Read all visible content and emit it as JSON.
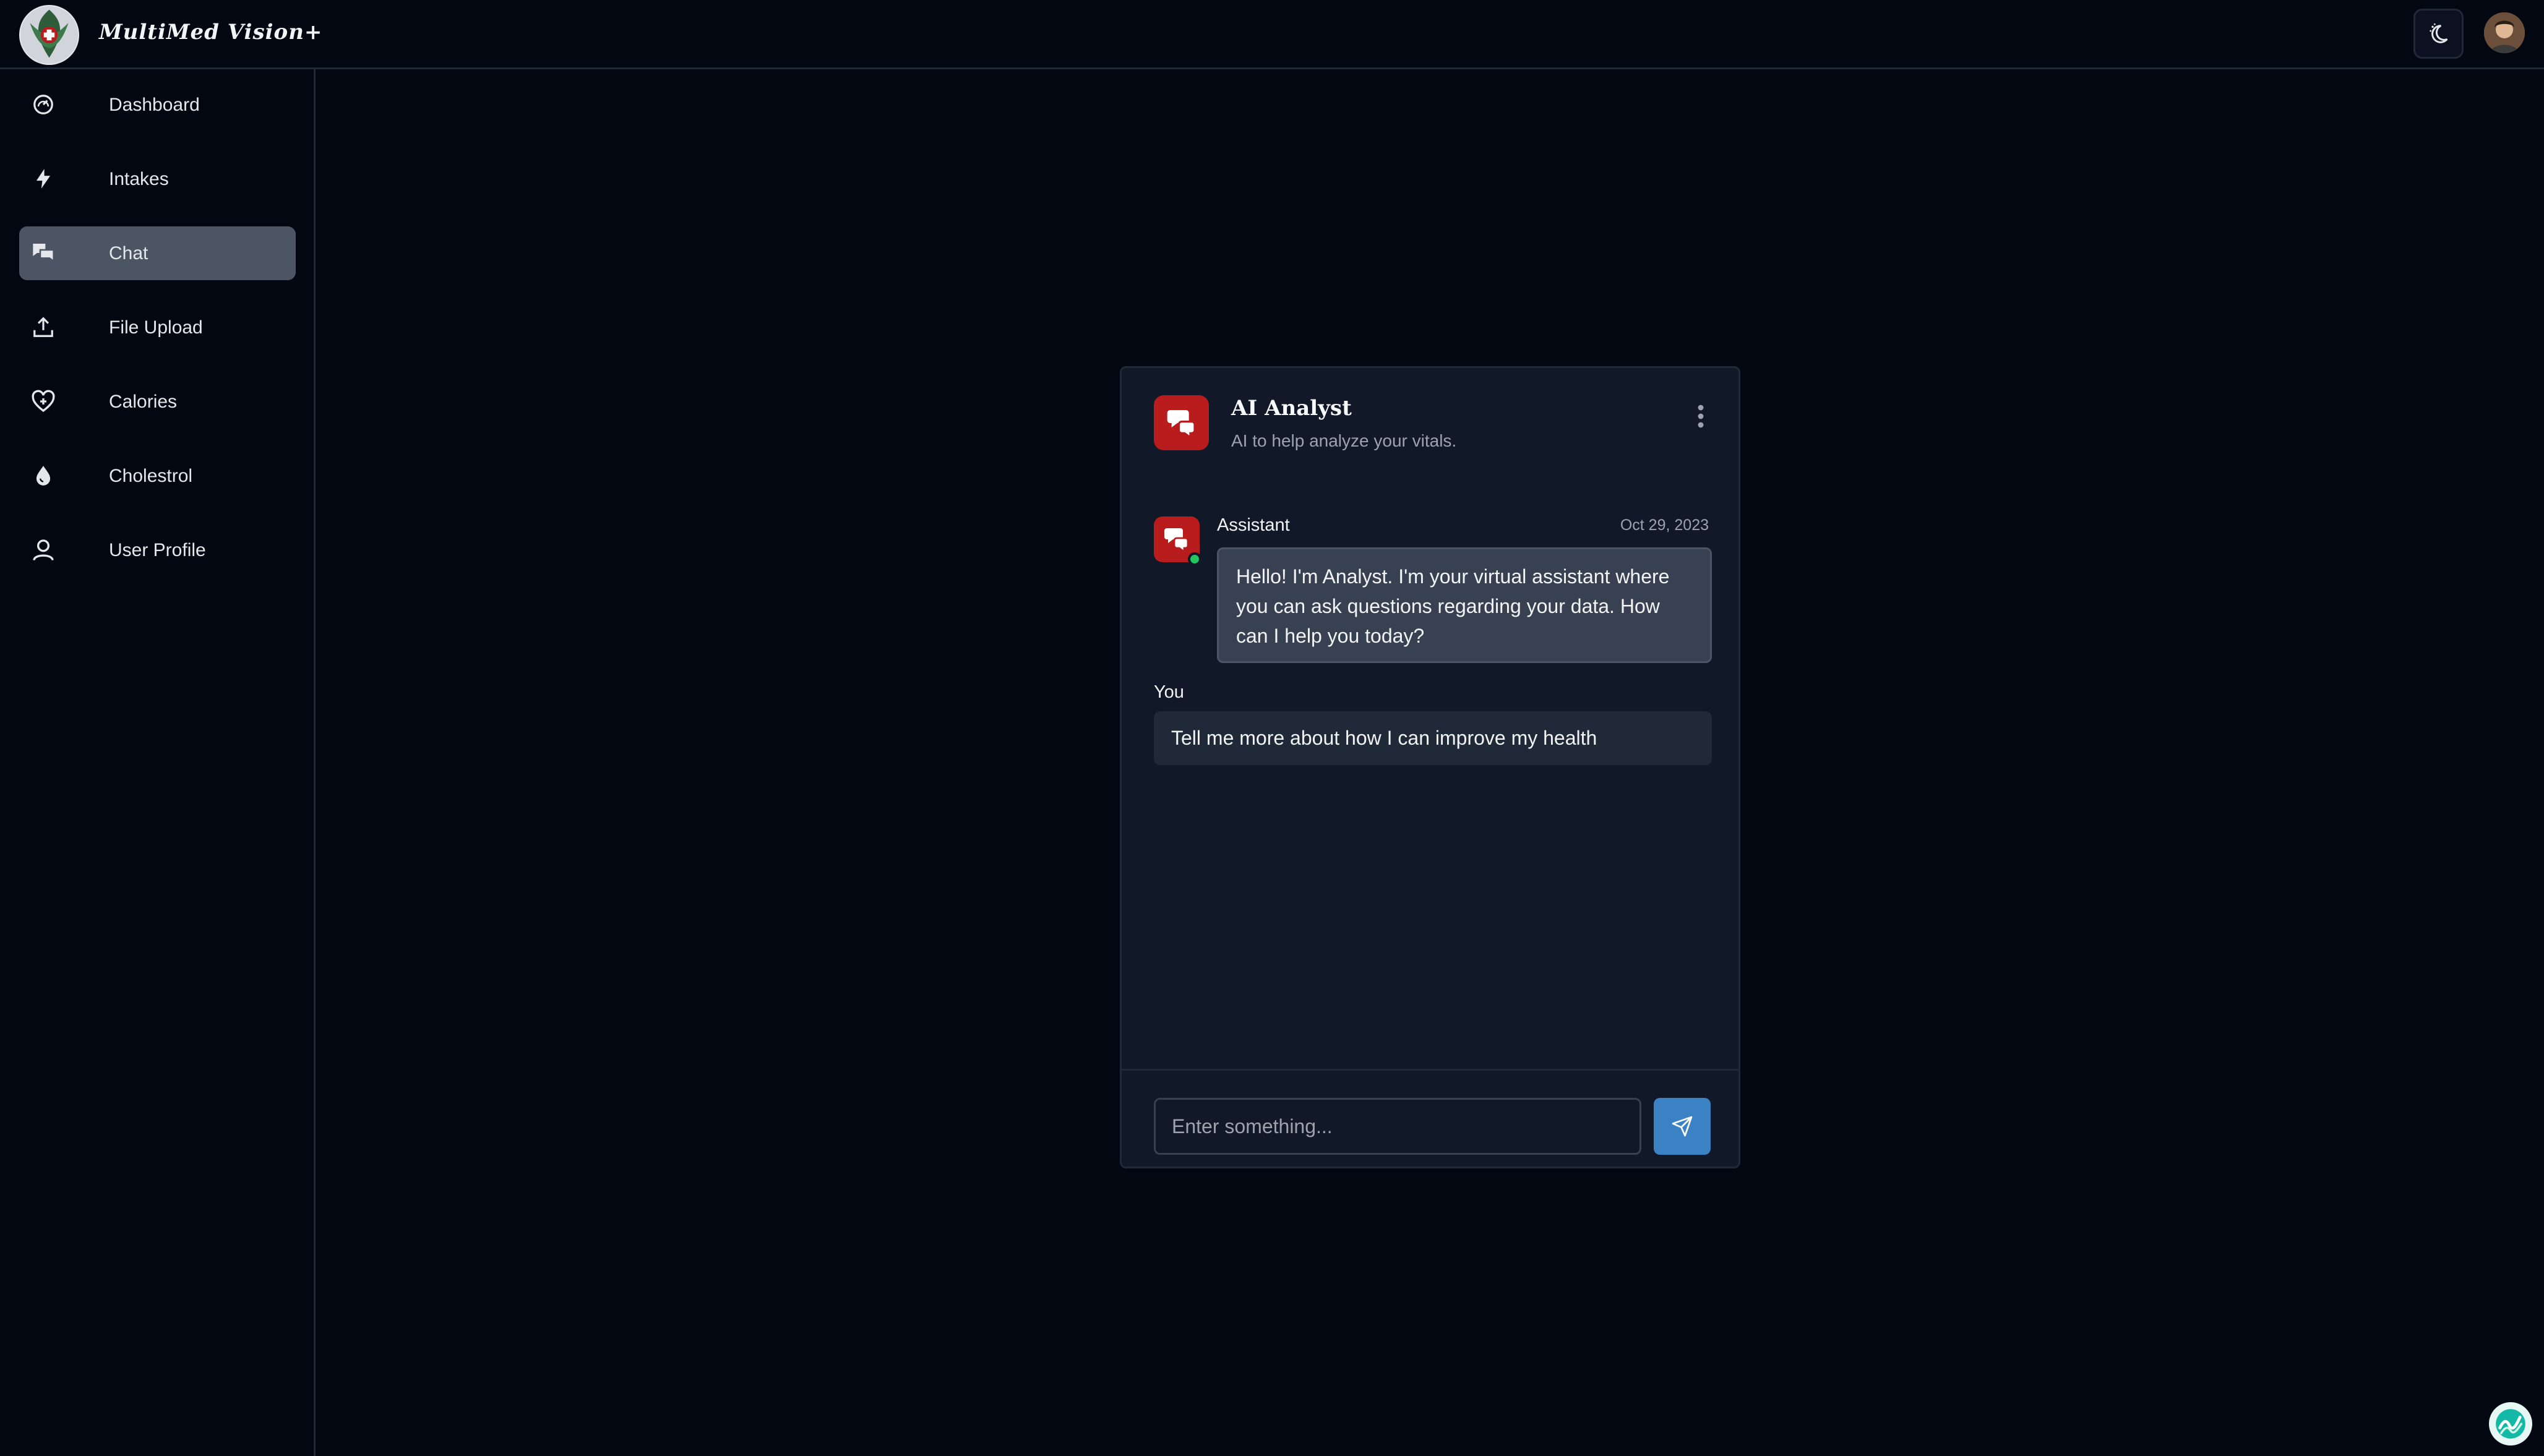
{
  "app": {
    "title": "MultiMed Vision+"
  },
  "header": {
    "theme_toggle_icon": "moon-sun-icon",
    "avatar_icon": "user-avatar"
  },
  "sidebar": {
    "items": [
      {
        "label": "Dashboard",
        "icon": "dashboard-icon",
        "active": false
      },
      {
        "label": "Intakes",
        "icon": "bolt-icon",
        "active": false
      },
      {
        "label": "Chat",
        "icon": "chat-bubbles-icon",
        "active": true
      },
      {
        "label": "File Upload",
        "icon": "upload-icon",
        "active": false
      },
      {
        "label": "Calories",
        "icon": "heart-plus-icon",
        "active": false
      },
      {
        "label": "Cholestrol",
        "icon": "droplet-icon",
        "active": false
      },
      {
        "label": "User Profile",
        "icon": "user-icon",
        "active": false
      }
    ]
  },
  "chat": {
    "title": "AI Analyst",
    "subtitle": "AI to help analyze your vitals.",
    "messages": [
      {
        "sender": "Assistant",
        "time": "Oct 29, 2023",
        "text": "Hello! I'm Analyst. I'm your virtual assistant where you can ask questions regarding your data. How can I help you today?"
      },
      {
        "sender": "You",
        "text": "Tell me more about how I can improve my health"
      }
    ],
    "input": {
      "placeholder": "Enter something...",
      "value": ""
    }
  },
  "colors": {
    "background": "#030712",
    "panel": "#111827",
    "active_nav": "#4b5563",
    "brand_red": "#b91c1c",
    "send_blue": "#3b82c4",
    "online_green": "#22c55e"
  }
}
